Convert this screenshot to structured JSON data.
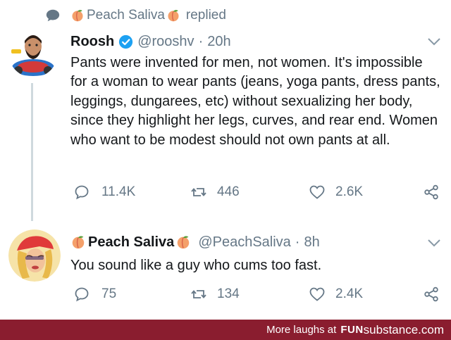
{
  "replied_header": {
    "user": "Peach Saliva",
    "action": "replied"
  },
  "tweet1": {
    "name": "Roosh",
    "handle": "@rooshv",
    "separator": "·",
    "time": "20h",
    "text": "Pants were invented for men, not women. It's impossible for a woman to wear pants (jeans, yoga pants, dress pants, leggings, dungarees, etc) without sexualizing her body, since they highlight her legs, curves, and rear end. Women who want to be modest should not own pants at all.",
    "replies": "11.4K",
    "retweets": "446",
    "likes": "2.6K"
  },
  "tweet2": {
    "name": "Peach Saliva",
    "handle": "@PeachSaliva",
    "separator": "·",
    "time": "8h",
    "text": "You sound like a guy who cums too fast.",
    "replies": "75",
    "retweets": "134",
    "likes": "2.4K"
  },
  "footer": {
    "lead": "More laughs at",
    "brand_a": "FUN",
    "brand_b": "substance",
    "brand_c": ".com"
  },
  "colors": {
    "text": "#14171a",
    "muted": "#657786",
    "verified": "#1da1f2",
    "footer_bg": "#8a1d2f",
    "thread_line": "#cfd9de",
    "peach": "#f4a06a"
  },
  "icons": [
    "chat-bubble-icon",
    "peach-emoji-icon",
    "verified-badge-icon",
    "chevron-down-icon",
    "reply-icon",
    "retweet-icon",
    "like-icon",
    "share-icon"
  ]
}
